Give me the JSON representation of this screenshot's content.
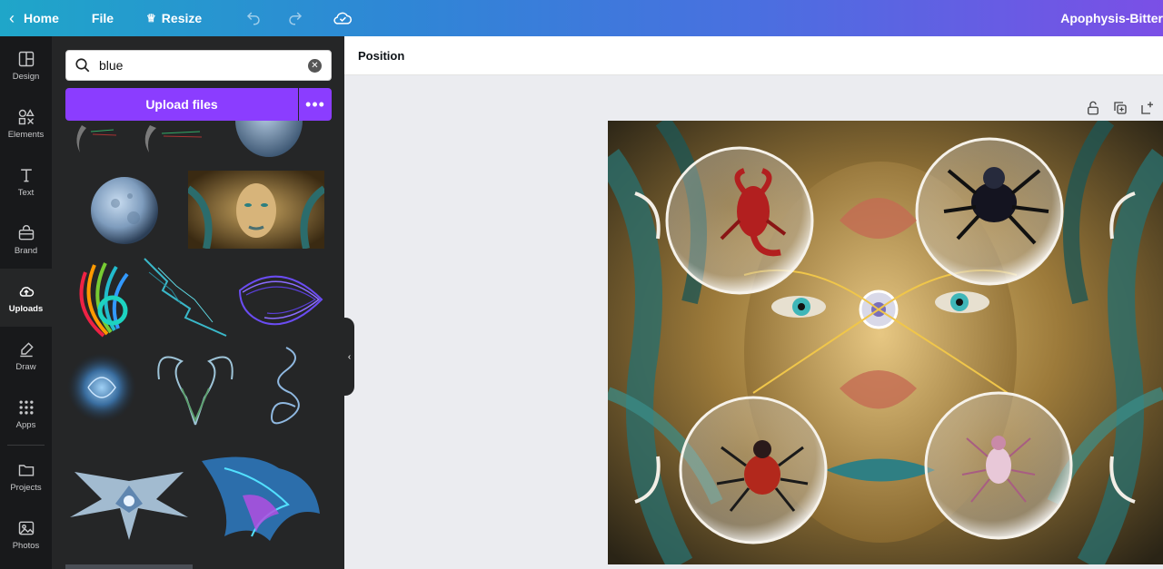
{
  "topbar": {
    "home_label": "Home",
    "file_label": "File",
    "resize_label": "Resize",
    "design_title": "Apophysis-Bitter"
  },
  "rail": {
    "items": [
      {
        "label": "Design",
        "icon": "layout-icon"
      },
      {
        "label": "Elements",
        "icon": "shapes-icon"
      },
      {
        "label": "Text",
        "icon": "text-icon"
      },
      {
        "label": "Brand",
        "icon": "briefcase-icon"
      },
      {
        "label": "Uploads",
        "icon": "cloud-upload-icon"
      },
      {
        "label": "Draw",
        "icon": "pen-icon"
      },
      {
        "label": "Apps",
        "icon": "apps-grid-icon"
      },
      {
        "label": "Projects",
        "icon": "folder-icon"
      },
      {
        "label": "Photos",
        "icon": "image-icon"
      }
    ],
    "active": "Uploads"
  },
  "panel": {
    "search_value": "blue",
    "upload_label": "Upload files",
    "more_label": "•••"
  },
  "toolbar": {
    "position_label": "Position"
  },
  "colors": {
    "accent": "#8b3dff",
    "rail_bg": "#18191b",
    "panel_bg": "#252627",
    "canvas_bg": "#ebecf0"
  }
}
